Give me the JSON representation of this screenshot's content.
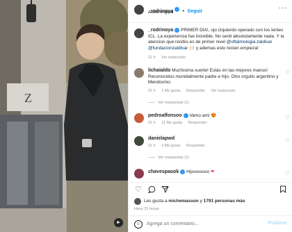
{
  "header": {
    "username": "_rodrinoya",
    "separator": "•",
    "follow_label": "Seguir",
    "audio": "Audio original"
  },
  "caption": {
    "username": "_rodrinoya",
    "text": "PRIMER DIA!, ojo izquierdo operado con los lentes ICL. La experiencia fue increible. No senti absolutamente nada. Y la atencion que recibis es de primer nivel",
    "mention1": "@oftalmologia.zaldivar",
    "mention2": "@fundacionzaldivar",
    "text_end": "🙌🏻 y ademas esto recien empieza!",
    "time": "21 h",
    "translation": "Ver traducción"
  },
  "comments": [
    {
      "username": "lichaialdo",
      "text": "Muchisima suerte! Estás en las mejores manos! Reconocidos mundialmente padre e hijo. Otro orgullo argentino y Mendocino.",
      "time": "21 h",
      "likes": "1 Me gusta",
      "reply": "Responder",
      "translation": "Ver traducción",
      "view_replies": "Ver respuestas (1)"
    },
    {
      "username": "pedroalfonsoo",
      "text": "Vamo ami 😍",
      "time": "21 h",
      "likes": "11 Me gusta",
      "reply": "Responder"
    },
    {
      "username": "danielapwd",
      "text": "",
      "time": "21 h",
      "likes": "2 Me gusta",
      "reply": "Responder",
      "view_replies": "Ver respuestas (1)"
    },
    {
      "username": "chavespauok",
      "text": "Hijooooooo"
    }
  ],
  "likes": {
    "prefix": "Les gusta a",
    "user": "michemasson",
    "connector": "y",
    "others": "1791 personas más",
    "time": "Hace 21 horas"
  },
  "comment_box": {
    "placeholder": "Agrega un comentario...",
    "post_label": "Publicar"
  },
  "colors": {
    "accent": "#0095f6",
    "verified": "#3897f0",
    "link": "#00376b",
    "muted": "#8e8e8e"
  }
}
